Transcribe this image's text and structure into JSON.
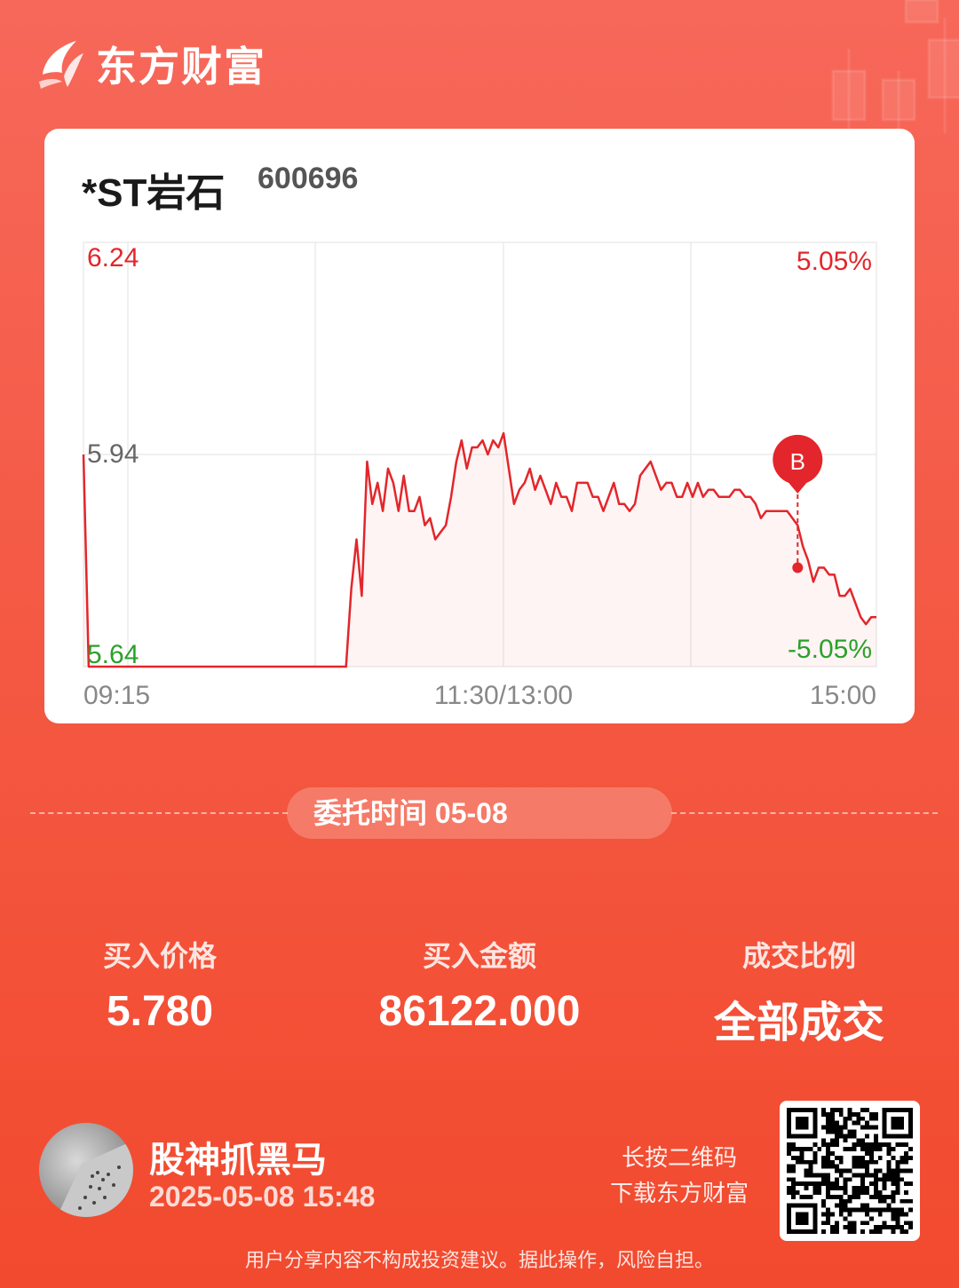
{
  "brand": {
    "name": "东方财富"
  },
  "stock": {
    "name": "*ST岩石",
    "code": "600696"
  },
  "chart_data": {
    "type": "line",
    "y_ticks": [
      "6.24",
      "5.94",
      "5.64"
    ],
    "pct_ticks": [
      "5.05%",
      "-5.05%"
    ],
    "x_ticks": [
      "09:15",
      "11:30/13:00",
      "15:00"
    ],
    "ylim": [
      5.64,
      6.24
    ],
    "marker_label": "B",
    "marker_price": 5.78,
    "series": [
      {
        "values": [
          5.94,
          5.64,
          5.64,
          5.64,
          5.64,
          5.64,
          5.64,
          5.64,
          5.64,
          5.64,
          5.64,
          5.64,
          5.64,
          5.64,
          5.64,
          5.64,
          5.64,
          5.64,
          5.64,
          5.64,
          5.64,
          5.64,
          5.64,
          5.64,
          5.64,
          5.64,
          5.64,
          5.64,
          5.64,
          5.64,
          5.64,
          5.64,
          5.64,
          5.64,
          5.64,
          5.64,
          5.64,
          5.64,
          5.64,
          5.64,
          5.64,
          5.64,
          5.64,
          5.64,
          5.64,
          5.64,
          5.64,
          5.64,
          5.64,
          5.64,
          5.64,
          5.75,
          5.82,
          5.74,
          5.93,
          5.87,
          5.9,
          5.86,
          5.92,
          5.9,
          5.86,
          5.91,
          5.86,
          5.86,
          5.88,
          5.84,
          5.85,
          5.82,
          5.83,
          5.84,
          5.88,
          5.93,
          5.96,
          5.92,
          5.95,
          5.95,
          5.96,
          5.94,
          5.96,
          5.95,
          5.97,
          5.92,
          5.87,
          5.89,
          5.9,
          5.92,
          5.89,
          5.91,
          5.89,
          5.87,
          5.9,
          5.88,
          5.88,
          5.86,
          5.9,
          5.9,
          5.9,
          5.88,
          5.88,
          5.86,
          5.88,
          5.9,
          5.87,
          5.87,
          5.86,
          5.87,
          5.91,
          5.92,
          5.93,
          5.91,
          5.89,
          5.9,
          5.9,
          5.88,
          5.88,
          5.9,
          5.88,
          5.9,
          5.88,
          5.89,
          5.89,
          5.88,
          5.88,
          5.88,
          5.89,
          5.89,
          5.88,
          5.88,
          5.87,
          5.85,
          5.86,
          5.86,
          5.86,
          5.86,
          5.86,
          5.85,
          5.84,
          5.81,
          5.79,
          5.76,
          5.78,
          5.78,
          5.77,
          5.77,
          5.74,
          5.74,
          5.75,
          5.73,
          5.71,
          5.7,
          5.71,
          5.71
        ],
        "marker_index": 136
      }
    ]
  },
  "order": {
    "time_label": "委托时间 05-08"
  },
  "stats": [
    {
      "label": "买入价格",
      "value": "5.780"
    },
    {
      "label": "买入金额",
      "value": "86122.000"
    },
    {
      "label": "成交比例",
      "value": "全部成交"
    }
  ],
  "user": {
    "name": "股神抓黑马",
    "datetime": "2025-05-08 15:48"
  },
  "qr": {
    "hint_line1": "长按二维码",
    "hint_line2": "下载东方财富"
  },
  "disclaimer": "用户分享内容不构成投资建议。据此操作，风险自担。",
  "colors": {
    "up": "#e3262b",
    "down": "#2aa12a",
    "neutral": "#666666",
    "bg_top": "#f7685a",
    "bg_bottom": "#f24a2e"
  }
}
